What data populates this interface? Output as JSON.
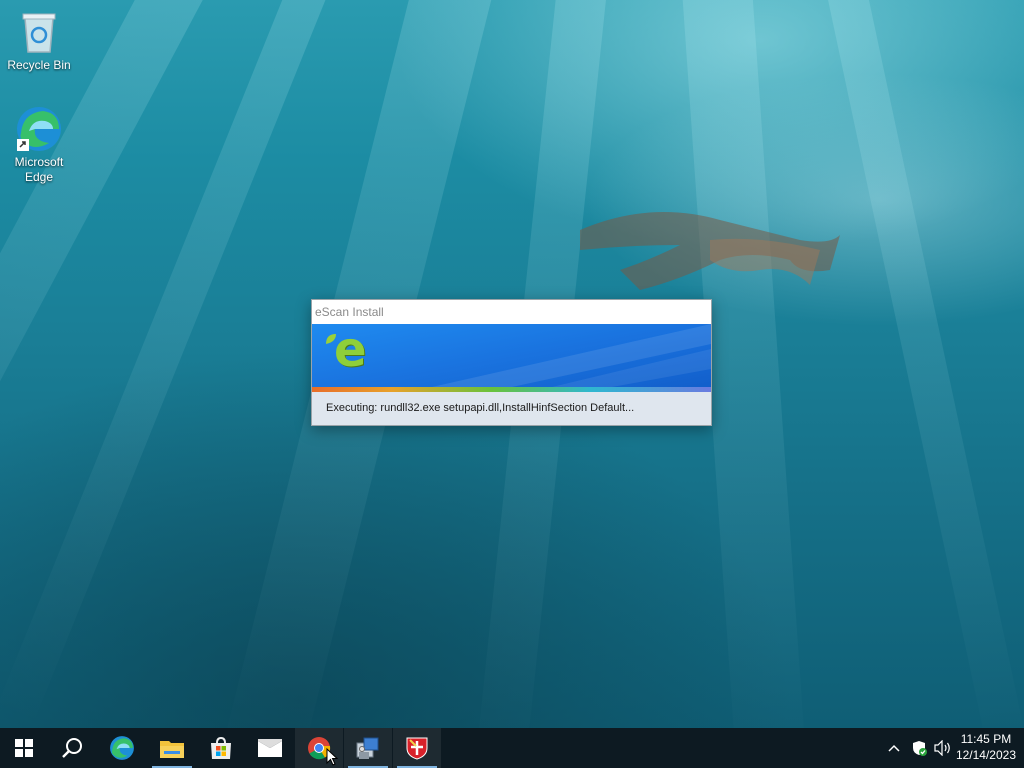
{
  "desktop": {
    "icons": [
      {
        "label": "Recycle Bin"
      },
      {
        "label": "Microsoft Edge"
      }
    ]
  },
  "dialog": {
    "title": "eScan Install",
    "logo_text": "e",
    "status": "Executing: rundll32.exe setupapi.dll,InstallHinfSection Default..."
  },
  "taskbar": {
    "items": [
      "start-icon",
      "search-icon",
      "edge-icon",
      "file-explorer-icon",
      "store-icon",
      "mail-icon",
      "chrome-icon",
      "installer-icon",
      "escan-icon"
    ],
    "clock": {
      "time": "11:45 PM",
      "date": "12/14/2023"
    }
  },
  "colors": {
    "taskbar": "#0d1a22",
    "banner": "#1a73df",
    "status_bg": "#dfe6ee"
  }
}
